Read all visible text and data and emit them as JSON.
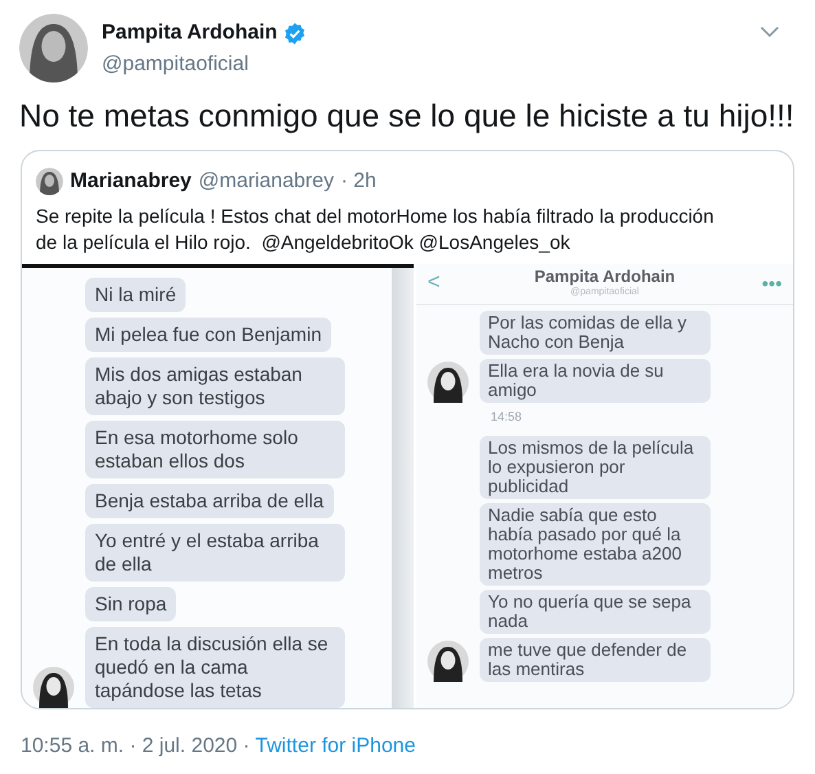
{
  "author": {
    "name": "Pampita Ardohain",
    "verified": true,
    "handle": "@pampitaoficial"
  },
  "text": "No te metas conmigo que se lo que le hiciste a tu hijo!!!",
  "quote": {
    "name": "Marianabrey",
    "handle": "@marianabrey",
    "time": "· 2h",
    "text": "Se repite la película ! Estos chat del motorHome los había filtrado la producción de la película el Hilo rojo.  @AngeldebritoOk @LosAngeles_ok",
    "left_chat": {
      "messages": [
        {
          "kind": "message",
          "text": "Ni la miré",
          "avatar": false
        },
        {
          "kind": "message",
          "text": "Mi pelea fue con Benjamin",
          "avatar": false
        },
        {
          "kind": "message",
          "text": "Mis dos amigas estaban abajo y son testigos",
          "avatar": false
        },
        {
          "kind": "message",
          "text": "En esa motorhome solo estaban ellos dos",
          "avatar": false
        },
        {
          "kind": "message",
          "text": "Benja estaba arriba de ella",
          "avatar": false
        },
        {
          "kind": "message",
          "text": "Yo entré y el estaba arriba de ella",
          "avatar": false
        },
        {
          "kind": "message",
          "text": "Sin ropa",
          "avatar": false
        },
        {
          "kind": "message",
          "text": "En toda la discusión ella se quedó en la cama tapándose las tetas",
          "avatar": true
        }
      ]
    },
    "right_chat": {
      "title": "Pampita Ardohain",
      "subtitle": "@pampitaoficial",
      "back": "<",
      "more": "•••",
      "messages": [
        {
          "kind": "message",
          "text": "Por las comidas de ella y Nacho con Benja",
          "avatar": false
        },
        {
          "kind": "message",
          "text": "Ella era la novia de su amigo",
          "avatar": true
        },
        {
          "kind": "time",
          "text": "14:58"
        },
        {
          "kind": "message",
          "text": "Los mismos de la película lo expusieron por publicidad",
          "avatar": false
        },
        {
          "kind": "message",
          "text": "Nadie sabía que esto había pasado por qué la motorhome estaba a200 metros",
          "avatar": false
        },
        {
          "kind": "message",
          "text": "Yo no quería que se sepa nada",
          "avatar": false
        },
        {
          "kind": "message",
          "text": "me tuve que defender de las mentiras",
          "avatar": true
        }
      ]
    }
  },
  "footer": {
    "timestamp": "10:55 a. m. · 2 jul. 2020 ·",
    "source": "Twitter for iPhone"
  }
}
